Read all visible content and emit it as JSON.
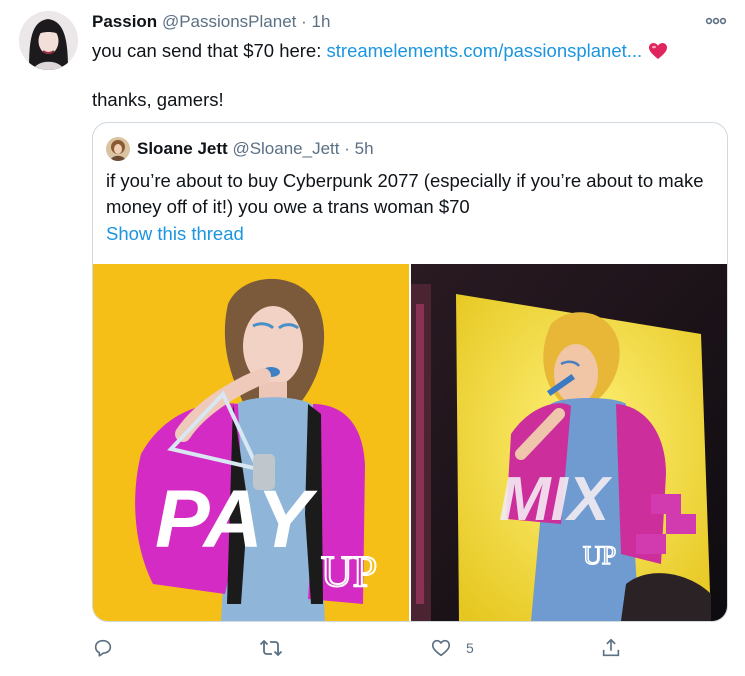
{
  "tweet": {
    "author_name": "Passion",
    "author_handle": "@PassionsPlanet",
    "separator": "·",
    "time": "1h",
    "text_prefix": "you can send that $70 here: ",
    "link_text": "streamelements.com/passionsplanet...",
    "text_line2": "thanks, gamers!"
  },
  "quoted": {
    "author_name": "Sloane Jett",
    "author_handle": "@Sloane_Jett",
    "separator": "·",
    "time": "5h",
    "text": "if you’re about to buy Cyberpunk 2077 (especially if you’re about to make money off of it!) you owe a trans woman $70",
    "show_thread": "Show this thread",
    "image_left": {
      "title": "PAY",
      "subtitle": "UP"
    },
    "image_right": {
      "title": "MIX",
      "subtitle": "UP"
    }
  },
  "actions": {
    "reply_count": "",
    "retweet_count": "",
    "like_count": "5"
  },
  "colors": {
    "link": "#1b95e0",
    "muted": "#5b7083",
    "heart": "#e0245e",
    "yellow": "#f7c21a",
    "magenta": "#d42bc4"
  },
  "icons": [
    "more-icon",
    "heart-emoji-icon",
    "reply-icon",
    "retweet-icon",
    "like-icon",
    "share-icon"
  ]
}
